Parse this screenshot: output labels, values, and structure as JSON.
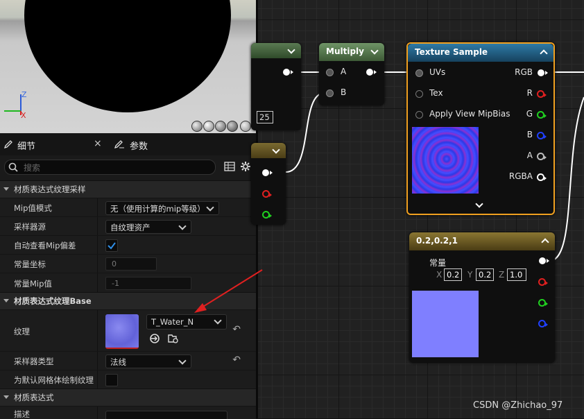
{
  "viewport": {
    "axis_z": "Z",
    "axis_x": "X"
  },
  "tabs": [
    {
      "label": "细节"
    },
    {
      "label": "参数"
    }
  ],
  "search": {
    "placeholder": "搜索"
  },
  "sections": {
    "sampling": {
      "title": "材质表达式纹理采样",
      "mip_mode_label": "Mip值模式",
      "mip_mode_value": "无（使用计算的mip等级）",
      "sampler_source_label": "采样器源",
      "sampler_source_value": "自纹理资产",
      "auto_mip_label": "自动查看Mip偏差",
      "auto_mip_checked": true,
      "const_coord_label": "常量坐标",
      "const_coord_value": "0",
      "const_mip_label": "常量Mip值",
      "const_mip_value": "-1"
    },
    "base": {
      "title": "材质表达式纹理Base",
      "texture_label": "纹理",
      "texture_value": "T_Water_N",
      "sampler_type_label": "采样器类型",
      "sampler_type_value": "法线",
      "default_mesh_label": "为默认网格体绘制纹理"
    },
    "expression": {
      "title": "材质表达式",
      "desc_label": "描述"
    }
  },
  "graph": {
    "partial_node_value": "25",
    "multiply": {
      "title": "Multiply",
      "pin_a": "A",
      "pin_b": "B"
    },
    "texture_sample": {
      "title": "Texture Sample",
      "inputs": [
        "UVs",
        "Tex",
        "Apply View MipBias"
      ],
      "outputs": [
        "RGB",
        "R",
        "G",
        "B",
        "A",
        "RGBA"
      ]
    },
    "constant": {
      "title": "0.2,0.2,1",
      "output_label": "常量",
      "x_label": "X",
      "x_value": "0.2",
      "y_label": "Y",
      "y_value": "0.2",
      "z_label": "Z",
      "z_value": "1.0"
    }
  },
  "watermark": "CSDN @Zhichao_97",
  "colors": {
    "annotation_arrow": "#e02020",
    "selection_outline": "#f0a020",
    "texture_header": "#1f5f86",
    "multiply_header": "#4d6a43",
    "constant_header": "#6b5a22",
    "constant_preview": "#7f7fff"
  }
}
